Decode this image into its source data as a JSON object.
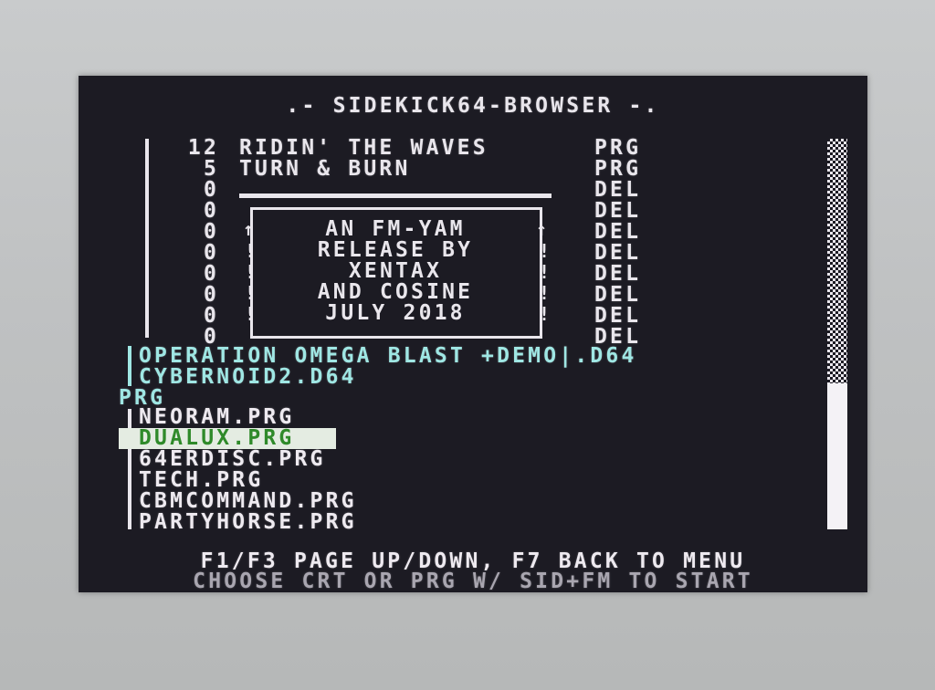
{
  "title": ".- SIDEKICK64-BROWSER -.",
  "archive_entries": [
    {
      "blocks": "12",
      "name": "RIDIN' THE WAVES",
      "type": "PRG"
    },
    {
      "blocks": "5",
      "name": "TURN & BURN",
      "type": "PRG"
    },
    {
      "blocks": "0",
      "name": "",
      "type": "DEL"
    },
    {
      "blocks": "0",
      "name": "",
      "type": "DEL"
    },
    {
      "blocks": "0",
      "name": "",
      "type": "DEL"
    },
    {
      "blocks": "0",
      "name": "",
      "type": "DEL"
    },
    {
      "blocks": "0",
      "name": "",
      "type": "DEL"
    },
    {
      "blocks": "0",
      "name": "",
      "type": "DEL"
    },
    {
      "blocks": "0",
      "name": "",
      "type": "DEL"
    },
    {
      "blocks": "0",
      "name": "",
      "type": "DEL"
    }
  ],
  "logo_box": {
    "lines": [
      "AN FM-YAM",
      "RELEASE BY",
      "XENTAX",
      "AND COSINE",
      "JULY 2018"
    ],
    "arrow_glyph": "↑",
    "side_glyph": "!"
  },
  "disk_images": [
    "OPERATION OMEGA BLAST +DEMO|.D64",
    "CYBERNOID2.D64"
  ],
  "section_label": "PRG",
  "programs": [
    {
      "name": "NEORAM.PRG",
      "selected": false
    },
    {
      "name": "DUALUX.PRG",
      "selected": true
    },
    {
      "name": "64ERDISC.PRG",
      "selected": false
    },
    {
      "name": "TECH.PRG",
      "selected": false
    },
    {
      "name": "CBMCOMMAND.PRG",
      "selected": false
    },
    {
      "name": "PARTYHORSE.PRG",
      "selected": false
    }
  ],
  "footer": {
    "line1": "F1/F3 PAGE UP/DOWN, F7 BACK TO MENU",
    "line2": "CHOOSE CRT OR PRG W/ SID+FM TO START"
  },
  "colors": {
    "screen_bg": "#1c1b23",
    "text_white": "#e9e6ec",
    "text_cyan": "#9fe7e4",
    "selected_text": "#2f8a2a",
    "selected_bg": "#e4ece2",
    "footer_gray": "#a9a6b0"
  },
  "icons": {
    "scrollbar": "checkered-scroll-track"
  }
}
